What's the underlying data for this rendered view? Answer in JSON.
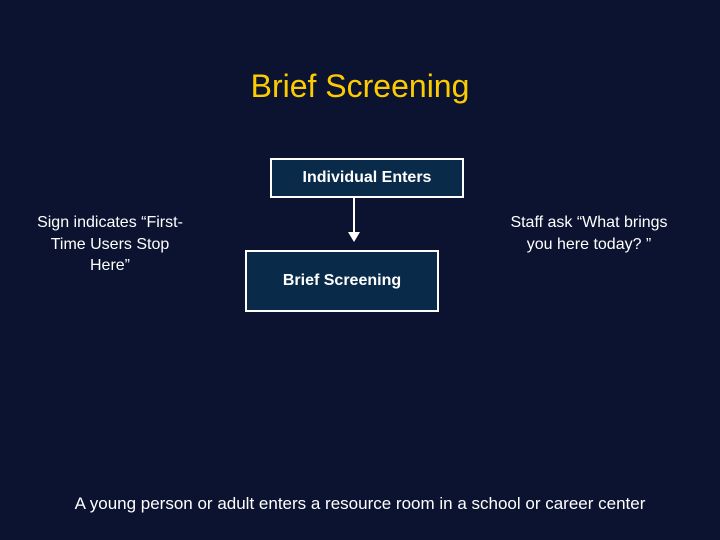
{
  "title": "Brief Screening",
  "box1": "Individual Enters",
  "box2": "Brief Screening",
  "left_note": "Sign indicates “First-Time Users Stop Here”",
  "right_note": "Staff ask “What brings you here today? ”",
  "caption": "A young person or adult enters a resource room in a school or career center"
}
